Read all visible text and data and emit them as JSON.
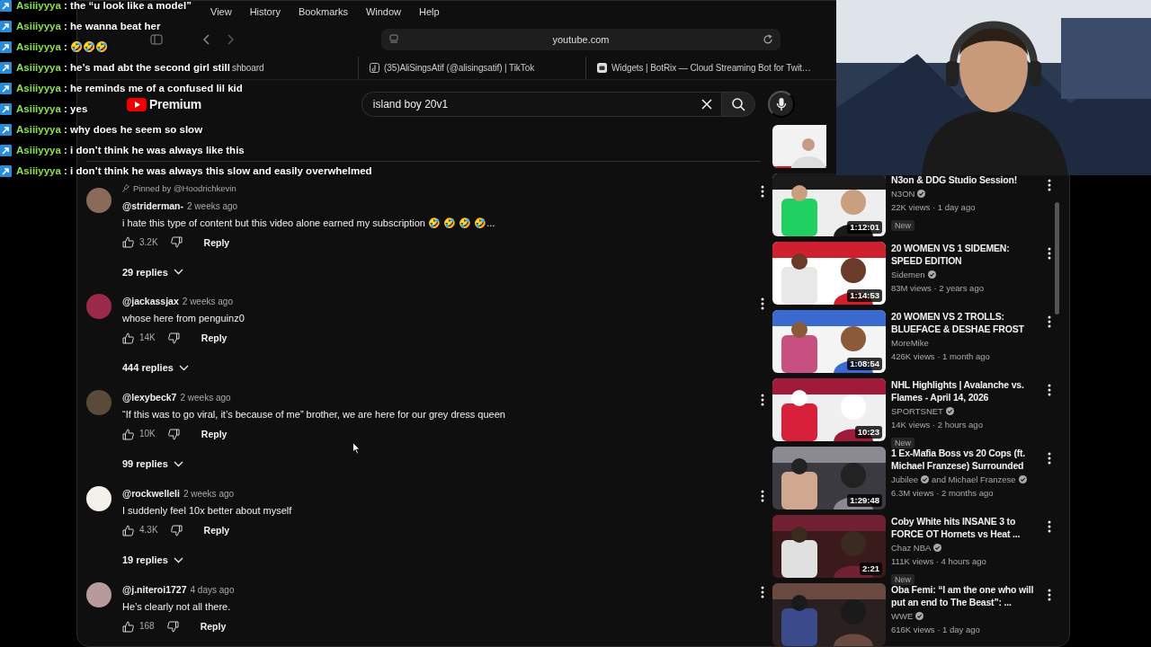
{
  "overlay_chat": [
    {
      "user": "Asiiiyyya",
      "message": ": the “u look like a model”"
    },
    {
      "user": "Asiiiyyya",
      "message": ": he wanna beat her"
    },
    {
      "user": "Asiiiyyya",
      "message": ": 🤣🤣🤣"
    },
    {
      "user": "Asiiiyyya",
      "message": ": he’s mad abt the second girl still"
    },
    {
      "user": "Asiiiyyya",
      "message": ": he reminds me of a confused lil kid"
    },
    {
      "user": "Asiiiyyya",
      "message": ": yes"
    },
    {
      "user": "Asiiiyyya",
      "message": ": why does he seem so slow"
    },
    {
      "user": "Asiiiyyya",
      "message": ": i don’t think he was always like this"
    },
    {
      "user": "Asiiiyyya",
      "message": ": i don’t think he was always this slow and easily overwhelmed"
    }
  ],
  "menu_bar": [
    "View",
    "History",
    "Bookmarks",
    "Window",
    "Help"
  ],
  "address_bar": "youtube.com",
  "browser_tabs": [
    {
      "label": "shboard",
      "kind": "plain"
    },
    {
      "label": "(35)AliSingsAtif (@alisingsatif) | TikTok",
      "kind": "tiktok"
    },
    {
      "label": "Widgets | BotRix — Cloud Streaming Bot for Twit…",
      "kind": "botrix"
    }
  ],
  "youtube": {
    "logo": "Premium",
    "search": "island boy 20v1"
  },
  "comments": [
    {
      "pinned": "Pinned by @Hoodrichkevin",
      "author": "@striderman-",
      "time": "2 weeks ago",
      "text": "i hate this type of content but this video alone earned my subscription 🤣 🤣 🤣 🤣...",
      "likes": "3.2K",
      "reply": "Reply",
      "replies": "29 replies"
    },
    {
      "author": "@jackassjax",
      "time": "2 weeks ago",
      "text": "whose here from penguinz0",
      "likes": "14K",
      "reply": "Reply",
      "replies": "444 replies"
    },
    {
      "author": "@lexybeck7",
      "time": "2 weeks ago",
      "text": "“If this was to go viral, it’s because of me” brother, we are here for our grey dress queen",
      "likes": "10K",
      "reply": "Reply",
      "replies": "99 replies"
    },
    {
      "author": "@rockwelleli",
      "time": "2 weeks ago",
      "text": "I suddenly feel 10x better about myself",
      "likes": "4.3K",
      "reply": "Reply",
      "replies": "19 replies"
    },
    {
      "author": "@j.niteroi1727",
      "time": "4 days ago",
      "text": "He’s clearly not all there.",
      "likes": "168",
      "reply": "Reply"
    }
  ],
  "recommended": [
    {
      "title": "N3on & DDG Studio Session!",
      "channels": [
        {
          "name": "N3ON",
          "verified": true
        }
      ],
      "meta": "22K views · 1 day ago",
      "badge": "New",
      "duration": "1:12:01"
    },
    {
      "title": "20 WOMEN VS 1 SIDEMEN: SPEED EDITION",
      "channels": [
        {
          "name": "Sidemen",
          "verified": true
        }
      ],
      "meta": "83M views · 2 years ago",
      "duration": "1:14:53"
    },
    {
      "title": "20 WOMEN VS 2 TROLLS: BLUEFACE & DESHAE FROST",
      "channels": [
        {
          "name": "MoreMike",
          "verified": false
        }
      ],
      "meta": "426K views · 1 month ago",
      "duration": "1:08:54"
    },
    {
      "title": "NHL Highlights | Avalanche vs. Flames - April 14, 2026",
      "channels": [
        {
          "name": "SPORTSNET",
          "verified": true
        }
      ],
      "meta": "14K views · 2 hours ago",
      "badge": "New",
      "duration": "10:23"
    },
    {
      "title": "1 Ex-Mafia Boss vs 20 Cops (ft. Michael Franzese) Surrounded",
      "channels": [
        {
          "name": "Jubilee",
          "verified": true
        },
        {
          "name": "and Michael Franzese",
          "verified": true
        }
      ],
      "meta": "6.3M views · 2 months ago",
      "duration": "1:29:48"
    },
    {
      "title": "Coby White hits INSANE 3 to FORCE OT Hornets vs Heat ...",
      "channels": [
        {
          "name": "Chaz NBA",
          "verified": true
        }
      ],
      "meta": "111K views · 4 hours ago",
      "badge": "New",
      "duration": "2:21"
    },
    {
      "title": "Oba Femi: “I am the one who will put an end to The Beast”: ...",
      "channels": [
        {
          "name": "WWE",
          "verified": true
        }
      ],
      "meta": "616K views · 1 day ago"
    }
  ]
}
